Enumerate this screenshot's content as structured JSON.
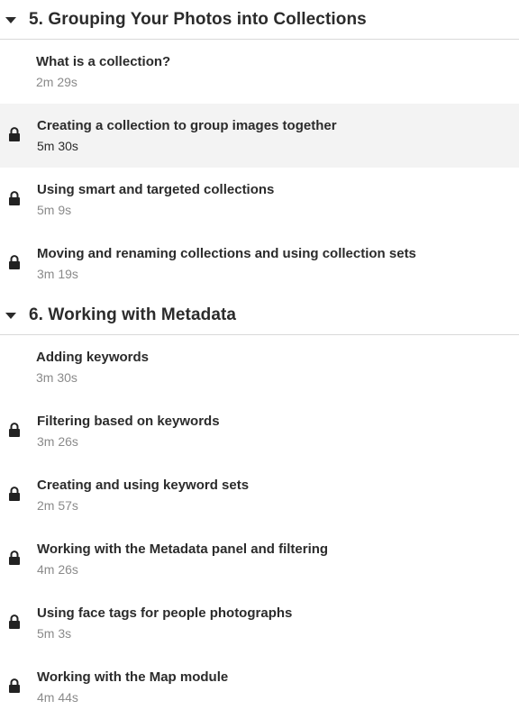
{
  "chapters": [
    {
      "title": "5. Grouping Your Photos into Collections",
      "videos": [
        {
          "title": "What is a collection?",
          "duration": "2m 29s",
          "locked": false
        },
        {
          "title": "Creating a collection to group images together",
          "duration": "5m 30s",
          "locked": true
        },
        {
          "title": "Using smart and targeted collections",
          "duration": "5m 9s",
          "locked": true
        },
        {
          "title": "Moving and renaming collections and using collection sets",
          "duration": "3m 19s",
          "locked": true
        }
      ]
    },
    {
      "title": "6. Working with Metadata",
      "videos": [
        {
          "title": "Adding keywords",
          "duration": "3m 30s",
          "locked": false
        },
        {
          "title": "Filtering based on keywords",
          "duration": "3m 26s",
          "locked": true
        },
        {
          "title": "Creating and using keyword sets",
          "duration": "2m 57s",
          "locked": true
        },
        {
          "title": "Working with the Metadata panel and filtering",
          "duration": "4m 26s",
          "locked": true
        },
        {
          "title": "Using face tags for people photographs",
          "duration": "5m 3s",
          "locked": true
        },
        {
          "title": "Working with the Map module",
          "duration": "4m 44s",
          "locked": true
        }
      ]
    }
  ],
  "icons": {
    "caret": "caret-down-icon",
    "lock": "lock-icon"
  }
}
